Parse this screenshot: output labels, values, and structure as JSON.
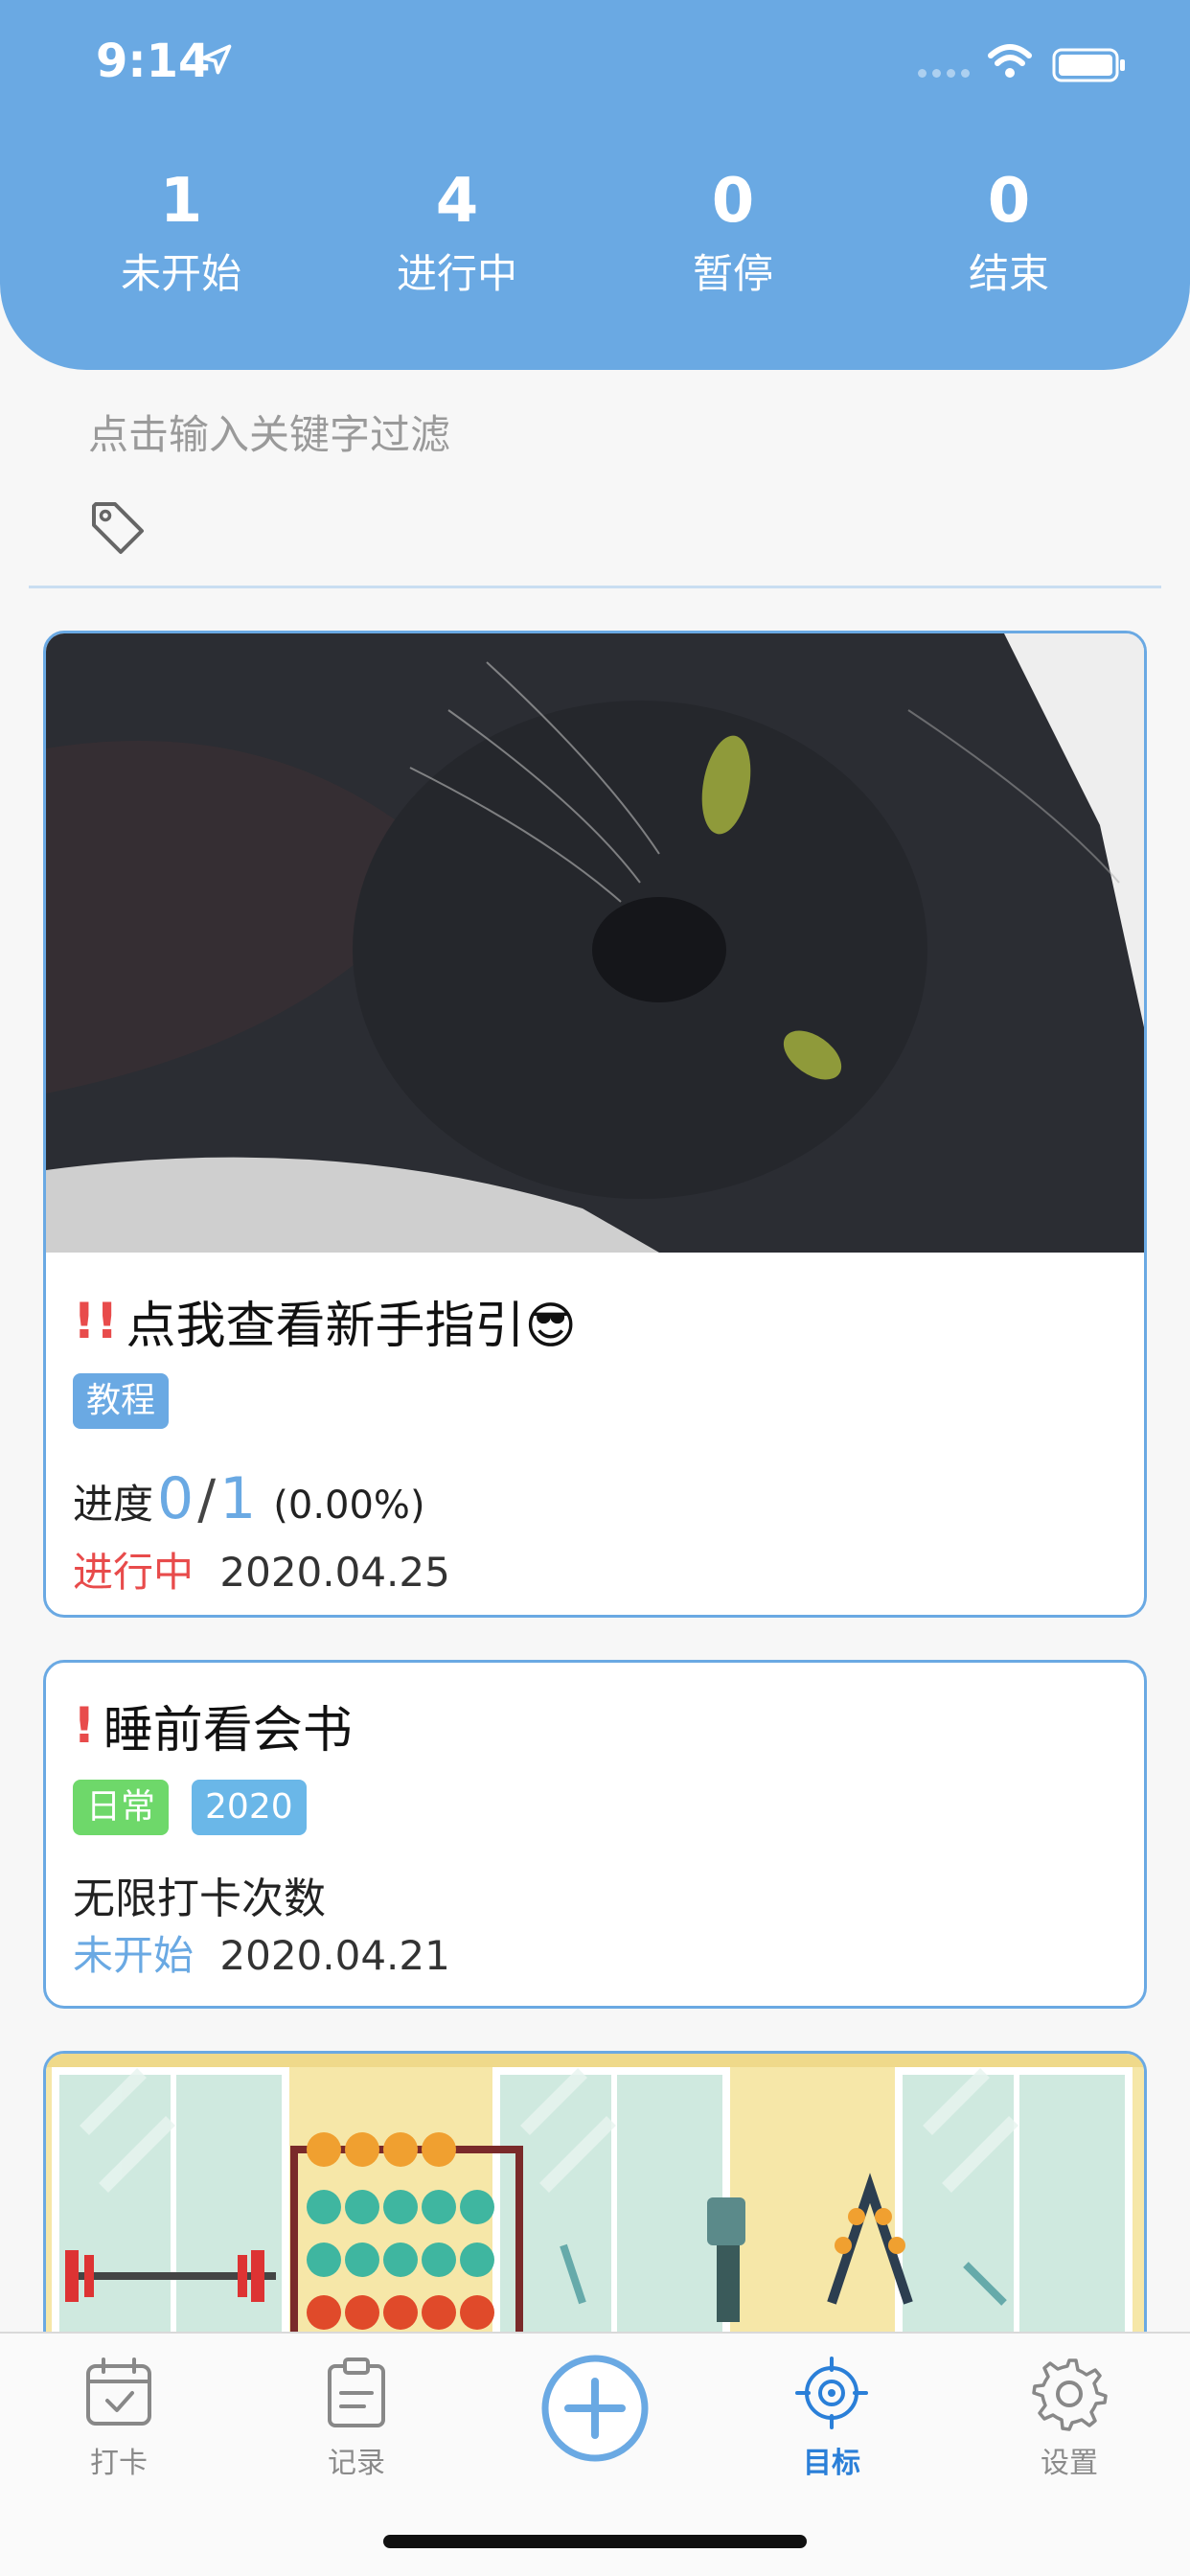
{
  "status_bar": {
    "time": "9:14"
  },
  "stats": [
    {
      "count": "1",
      "label": "未开始"
    },
    {
      "count": "4",
      "label": "进行中"
    },
    {
      "count": "0",
      "label": "暂停"
    },
    {
      "count": "0",
      "label": "结束"
    }
  ],
  "filter": {
    "placeholder": "点击输入关键字过滤"
  },
  "cards": [
    {
      "priority": "!!",
      "title": "点我查看新手指引😎",
      "tags": [
        {
          "label": "教程",
          "color": "#6aa9e3"
        }
      ],
      "progress_label": "进度",
      "progress_done": "0",
      "progress_total": "1",
      "progress_percent": "(0.00%)",
      "status": "进行中",
      "date": "2020.04.25"
    },
    {
      "priority": "!",
      "title": "睡前看会书",
      "tags": [
        {
          "label": "日常",
          "color": "#6ed86a"
        },
        {
          "label": "2020",
          "color": "#6ab7e8"
        }
      ],
      "limit_text": "无限打卡次数",
      "status": "未开始",
      "date": "2020.04.21"
    }
  ],
  "tabbar": {
    "items": [
      {
        "label": "打卡",
        "icon": "calendar-check-icon"
      },
      {
        "label": "记录",
        "icon": "clipboard-icon"
      },
      {
        "label": "",
        "icon": "add-circle-icon"
      },
      {
        "label": "目标",
        "icon": "target-icon"
      },
      {
        "label": "设置",
        "icon": "gear-icon"
      }
    ],
    "active_index": 3
  },
  "colors": {
    "accent": "#6aa9e3",
    "danger": "#e84b4b",
    "active_tab": "#2a7fd8"
  }
}
